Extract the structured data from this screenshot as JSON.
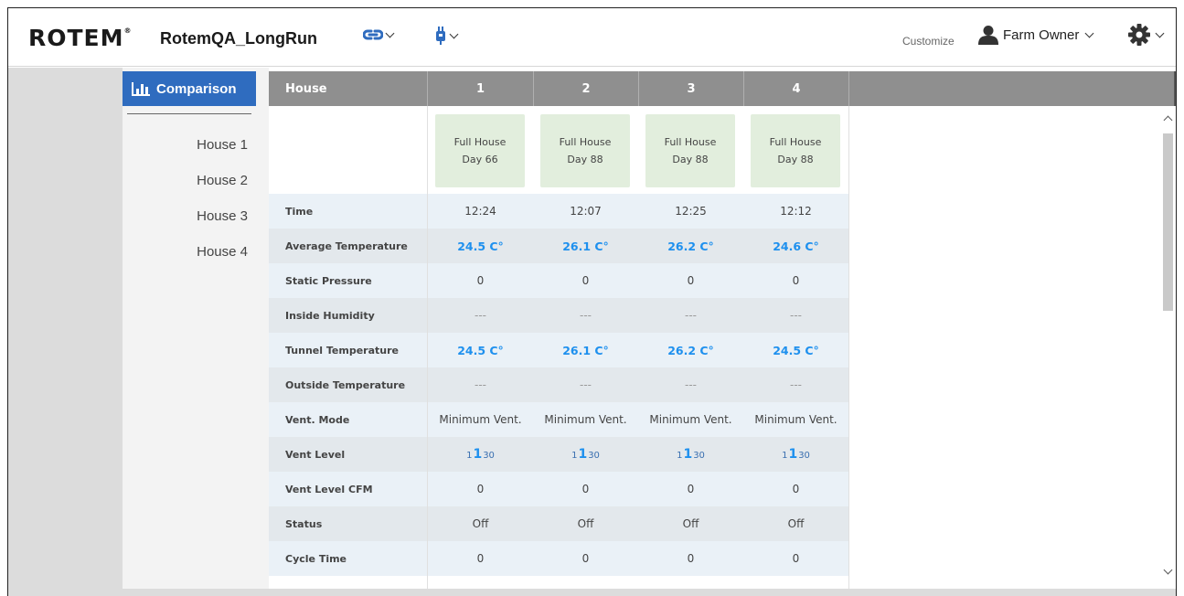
{
  "header": {
    "logo_text": "ROTEM",
    "logo_mark": "®",
    "farm_name": "RotemQA_LongRun",
    "customize_label": "Customize",
    "user_label": "Farm Owner"
  },
  "sidebar": {
    "comparison_label": "Comparison",
    "houses": [
      {
        "label": "House 1"
      },
      {
        "label": "House 2"
      },
      {
        "label": "House 3"
      },
      {
        "label": "House 4"
      }
    ]
  },
  "table": {
    "header_label": "House",
    "columns": [
      {
        "number": "1",
        "status_line1": "Full House",
        "status_line2": "Day 66"
      },
      {
        "number": "2",
        "status_line1": "Full House",
        "status_line2": "Day 88"
      },
      {
        "number": "3",
        "status_line1": "Full House",
        "status_line2": "Day 88"
      },
      {
        "number": "4",
        "status_line1": "Full House",
        "status_line2": "Day 88"
      }
    ],
    "rows": [
      {
        "label": "Time",
        "values": [
          "12:24",
          "12:07",
          "12:25",
          "12:12"
        ]
      },
      {
        "label": "Average Temperature",
        "values": [
          "24.5 C°",
          "26.1 C°",
          "26.2 C°",
          "24.6 C°"
        ]
      },
      {
        "label": "Static Pressure",
        "values": [
          "0",
          "0",
          "0",
          "0"
        ]
      },
      {
        "label": "Inside Humidity",
        "values": [
          "---",
          "---",
          "---",
          "---"
        ]
      },
      {
        "label": "Tunnel Temperature",
        "values": [
          "24.5 C°",
          "26.1 C°",
          "26.2 C°",
          "24.5 C°"
        ]
      },
      {
        "label": "Outside Temperature",
        "values": [
          "---",
          "---",
          "---",
          "---"
        ]
      },
      {
        "label": "Vent. Mode",
        "values": [
          "Minimum Vent.",
          "Minimum Vent.",
          "Minimum Vent.",
          "Minimum Vent."
        ]
      },
      {
        "label": "Vent Level",
        "vent_values": [
          {
            "min": "1",
            "level": "1",
            "max": "30"
          },
          {
            "min": "1",
            "level": "1",
            "max": "30"
          },
          {
            "min": "1",
            "level": "1",
            "max": "30"
          },
          {
            "min": "1",
            "level": "1",
            "max": "30"
          }
        ]
      },
      {
        "label": "Vent Level CFM",
        "values": [
          "0",
          "0",
          "0",
          "0"
        ]
      },
      {
        "label": "Status",
        "values": [
          "Off",
          "Off",
          "Off",
          "Off"
        ]
      },
      {
        "label": "Cycle Time",
        "values": [
          "0",
          "0",
          "0",
          "0"
        ]
      }
    ]
  },
  "colors": {
    "accent_blue": "#2f6cbf",
    "value_blue": "#1e90ee",
    "header_gray": "#8f8f8f",
    "card_green": "#e2eedd"
  },
  "icons": {
    "link": "link-icon",
    "plug": "plug-icon",
    "user": "user-icon",
    "settings": "gear-icon",
    "chart": "bar-chart-icon"
  }
}
